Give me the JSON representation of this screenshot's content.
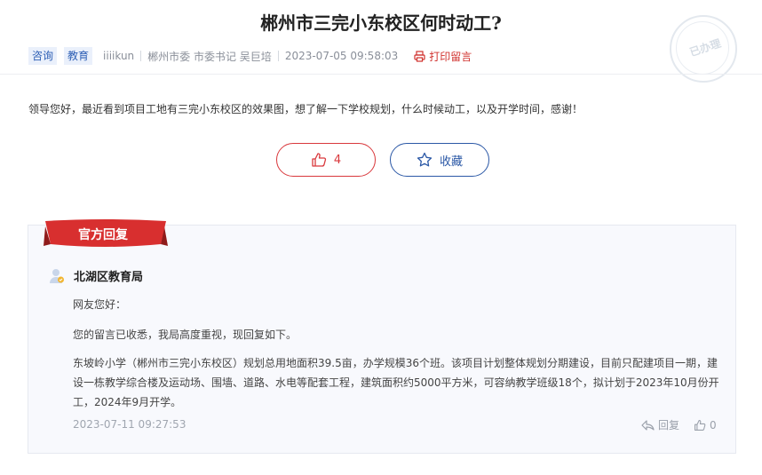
{
  "title": "郴州市三完小东校区何时动工?",
  "stamp": {
    "text": "已办理"
  },
  "meta": {
    "tags": [
      "咨询",
      "教育"
    ],
    "author": "iiiikun",
    "recipient": "郴州市委 市委书记 吴巨培",
    "datetime": "2023-07-05 09:58:03",
    "print_label": "打印留言"
  },
  "content": "领导您好，最近看到项目工地有三完小东校区的效果图，想了解一下学校规划，什么时候动工，以及开学时间，感谢！",
  "actions": {
    "like_count": "4",
    "favorite_label": "收藏"
  },
  "reply": {
    "ribbon_label": "官方回复",
    "org": "北湖区教育局",
    "greeting": "网友您好：",
    "paragraph1": "您的留言已收悉，我局高度重视，现回复如下。",
    "paragraph2": "东坡岭小学（郴州市三完小东校区）规划总用地面积39.5亩，办学规模36个班。该项目计划整体规划分期建设，目前只配建项目一期，建设一栋教学综合楼及运动场、围墙、道路、水电等配套工程，建筑面积约5000平方米，可容纳教学班级18个，拟计划于2023年10月份开工，2024年9月开学。",
    "time": "2023-07-11 09:27:53",
    "reply_label": "回复",
    "like_count": "0"
  },
  "colors": {
    "accent_red": "#d9383c",
    "accent_blue": "#2b58a6",
    "ribbon": "#d82f2f"
  }
}
